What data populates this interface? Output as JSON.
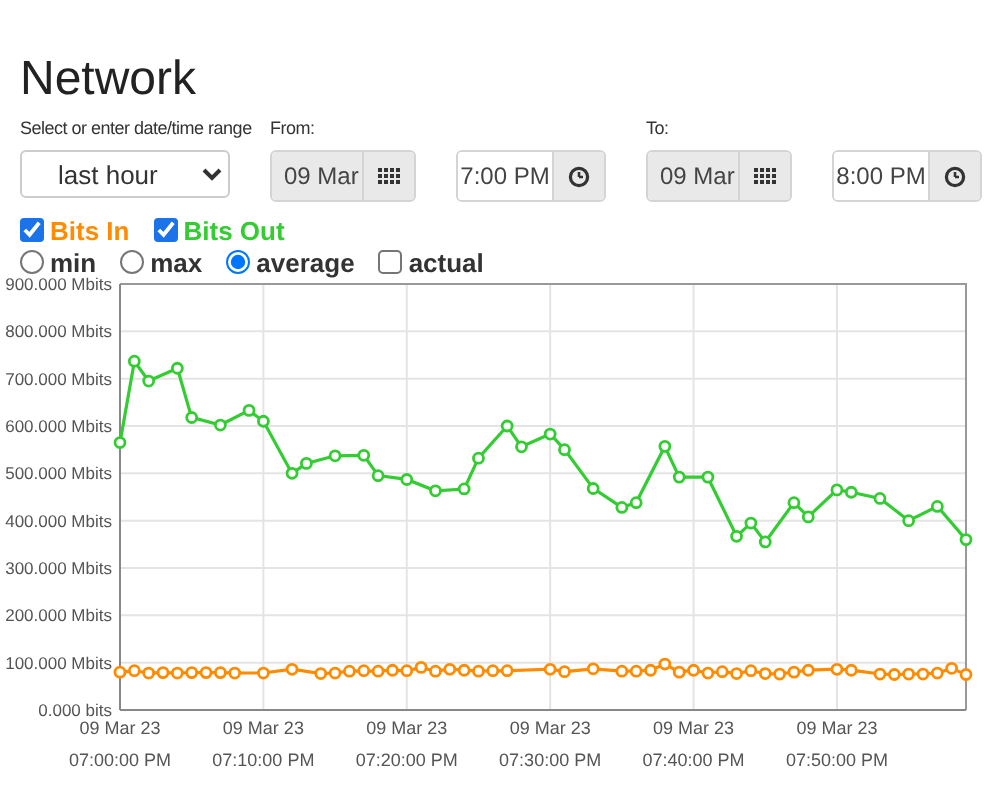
{
  "title": "Network",
  "range": {
    "label": "Select or enter date/time range",
    "value": "last hour"
  },
  "from": {
    "label": "From:",
    "date": {
      "value": "09 Mar",
      "readonly": true
    },
    "time": {
      "value": "7:00 PM",
      "readonly": false
    }
  },
  "to": {
    "label": "To:",
    "date": {
      "value": "09 Mar",
      "readonly": true
    },
    "time": {
      "value": "8:00 PM",
      "readonly": false
    }
  },
  "series_toggles": [
    {
      "label": "Bits In",
      "checked": true,
      "color": "#ff8c00"
    },
    {
      "label": "Bits Out",
      "checked": true,
      "color": "#33cc33"
    }
  ],
  "aggregation": [
    {
      "label": "min",
      "kind": "radio",
      "selected": false
    },
    {
      "label": "max",
      "kind": "radio",
      "selected": false
    },
    {
      "label": "average",
      "kind": "radio",
      "selected": true
    },
    {
      "label": "actual",
      "kind": "checkbox",
      "selected": false
    }
  ],
  "chart_data": {
    "type": "line",
    "grid": true,
    "ylim": [
      0,
      900
    ],
    "yticks": [
      {
        "value": 0,
        "label": "0.000 bits"
      },
      {
        "value": 100,
        "label": "100.000 Mbits"
      },
      {
        "value": 200,
        "label": "200.000 Mbits"
      },
      {
        "value": 300,
        "label": "300.000 Mbits"
      },
      {
        "value": 400,
        "label": "400.000 Mbits"
      },
      {
        "value": 500,
        "label": "500.000 Mbits"
      },
      {
        "value": 600,
        "label": "600.000 Mbits"
      },
      {
        "value": 700,
        "label": "700.000 Mbits"
      },
      {
        "value": 800,
        "label": "800.000 Mbits"
      },
      {
        "value": 900,
        "label": "900.000 Mbits"
      }
    ],
    "categories": [
      "09 Mar 23\n07:00:00 PM",
      null,
      null,
      null,
      null,
      null,
      null,
      null,
      null,
      null,
      "09 Mar 23\n07:10:00 PM",
      null,
      null,
      null,
      null,
      null,
      null,
      null,
      null,
      null,
      "09 Mar 23\n07:20:00 PM",
      null,
      null,
      null,
      null,
      null,
      null,
      null,
      null,
      null,
      "09 Mar 23\n07:30:00 PM",
      null,
      null,
      null,
      null,
      null,
      null,
      null,
      null,
      null,
      "09 Mar 23\n07:40:00 PM",
      null,
      null,
      null,
      null,
      null,
      null,
      null,
      null,
      null,
      "09 Mar 23\n07:50:00 PM",
      null,
      null,
      null,
      null,
      null,
      null,
      null,
      null,
      null
    ],
    "series": [
      {
        "color": "#33cc33",
        "marker": "circle",
        "values": [
          565,
          737,
          695,
          null,
          722,
          618,
          null,
          602,
          null,
          633,
          610,
          null,
          500,
          521,
          null,
          537,
          null,
          538,
          495,
          null,
          487,
          null,
          463,
          null,
          467,
          532,
          null,
          600,
          556,
          null,
          583,
          550,
          null,
          468,
          null,
          428,
          438,
          null,
          557,
          492,
          null,
          492,
          null,
          367,
          395,
          355,
          null,
          438,
          408,
          null,
          465,
          460,
          null,
          447,
          null,
          400,
          null,
          430,
          null,
          360
        ]
      },
      {
        "color": "#ff8c00",
        "marker": "circle",
        "values": [
          80,
          83,
          78,
          79,
          78,
          79,
          79,
          79,
          78,
          null,
          78,
          null,
          86,
          null,
          77,
          78,
          82,
          83,
          82,
          84,
          83,
          90,
          82,
          86,
          84,
          82,
          83,
          83,
          null,
          null,
          86,
          81,
          null,
          87,
          null,
          82,
          82,
          84,
          97,
          80,
          84,
          78,
          81,
          77,
          83,
          77,
          76,
          80,
          84,
          null,
          86,
          84,
          null,
          76,
          75,
          76,
          76,
          78,
          88,
          75
        ]
      }
    ]
  }
}
